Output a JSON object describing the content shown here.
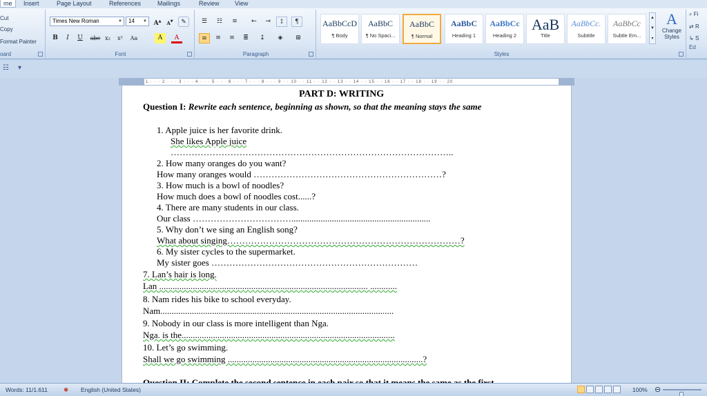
{
  "tabs": [
    "me",
    "Insert",
    "Page Layout",
    "References",
    "Mailings",
    "Review",
    "View"
  ],
  "clipboard": {
    "cut": "Cut",
    "copy": "Copy",
    "format_painter": "Format Painter",
    "label": "oard"
  },
  "font": {
    "name": "Times New Roman",
    "size": "14",
    "label": "Font",
    "buttons": [
      "B",
      "I",
      "U",
      "abe",
      "x₂",
      "x²",
      "Aa",
      "A",
      "A"
    ]
  },
  "paragraph": {
    "label": "Paragraph"
  },
  "styles": {
    "label": "Styles",
    "items": [
      {
        "sample": "AaBbCcD",
        "name": "¶ Body"
      },
      {
        "sample": "AaBbC",
        "name": "¶ No Spaci..."
      },
      {
        "sample": "AaBbC",
        "name": "¶ Normal"
      },
      {
        "sample": "AaBbC",
        "name": "Heading 1"
      },
      {
        "sample": "AaBbCc",
        "name": "Heading 2"
      },
      {
        "sample": "AaB",
        "name": "Title"
      },
      {
        "sample": "AaBbCc.",
        "name": "Subtitle"
      },
      {
        "sample": "AaBbCc",
        "name": "Subtle Em..."
      }
    ],
    "change_styles": "Change Styles"
  },
  "editing": {
    "label": "Ed",
    "find": "Fi",
    "replace": "R",
    "select": "S"
  },
  "document": {
    "heading": "PART D: WRITING",
    "q1_label": "Question I:",
    "q1_text": "Rewrite each sentence, beginning as shown, so that the meaning stays the same",
    "lines": [
      "1.  Apple juice is her favorite drink.",
      "She  likes Apple juice",
      "…………………………………………………………………………………..",
      "2.  How many oranges do you want?",
      "How many oranges would ………………………………………………………?",
      "3.  How much is a bowl of noodles?",
      "How much does a bowl of noodles cost......?",
      "4.  There are many students in our class.",
      "Our class ……………………………..............................................................",
      "5.  Why don’t we sing an English song?",
      "What about  singing……………………………………………………………………?",
      "6.  My sister cycles to the supermarket.",
      "My sister goes ……………………………………………………………",
      "7. Lan’s hair is long.",
      "Lan .............................................................................................  ............",
      "8. Nam rides his bike to school everyday.",
      "Nam........................................................................................................",
      "9. Nobody in our class is more intelligent than Nga.",
      "Nga. is  the...............................................................................................",
      "10. Let’s go swimming.",
      "Shall we go swimming  .......................................................................................?"
    ],
    "partial_heading": "Question II:   Complete the second sentence in each pair so that it means the same as the first"
  },
  "status": {
    "words": "Words: 11/1.611",
    "language": "English (United States)",
    "zoom": "100%"
  }
}
